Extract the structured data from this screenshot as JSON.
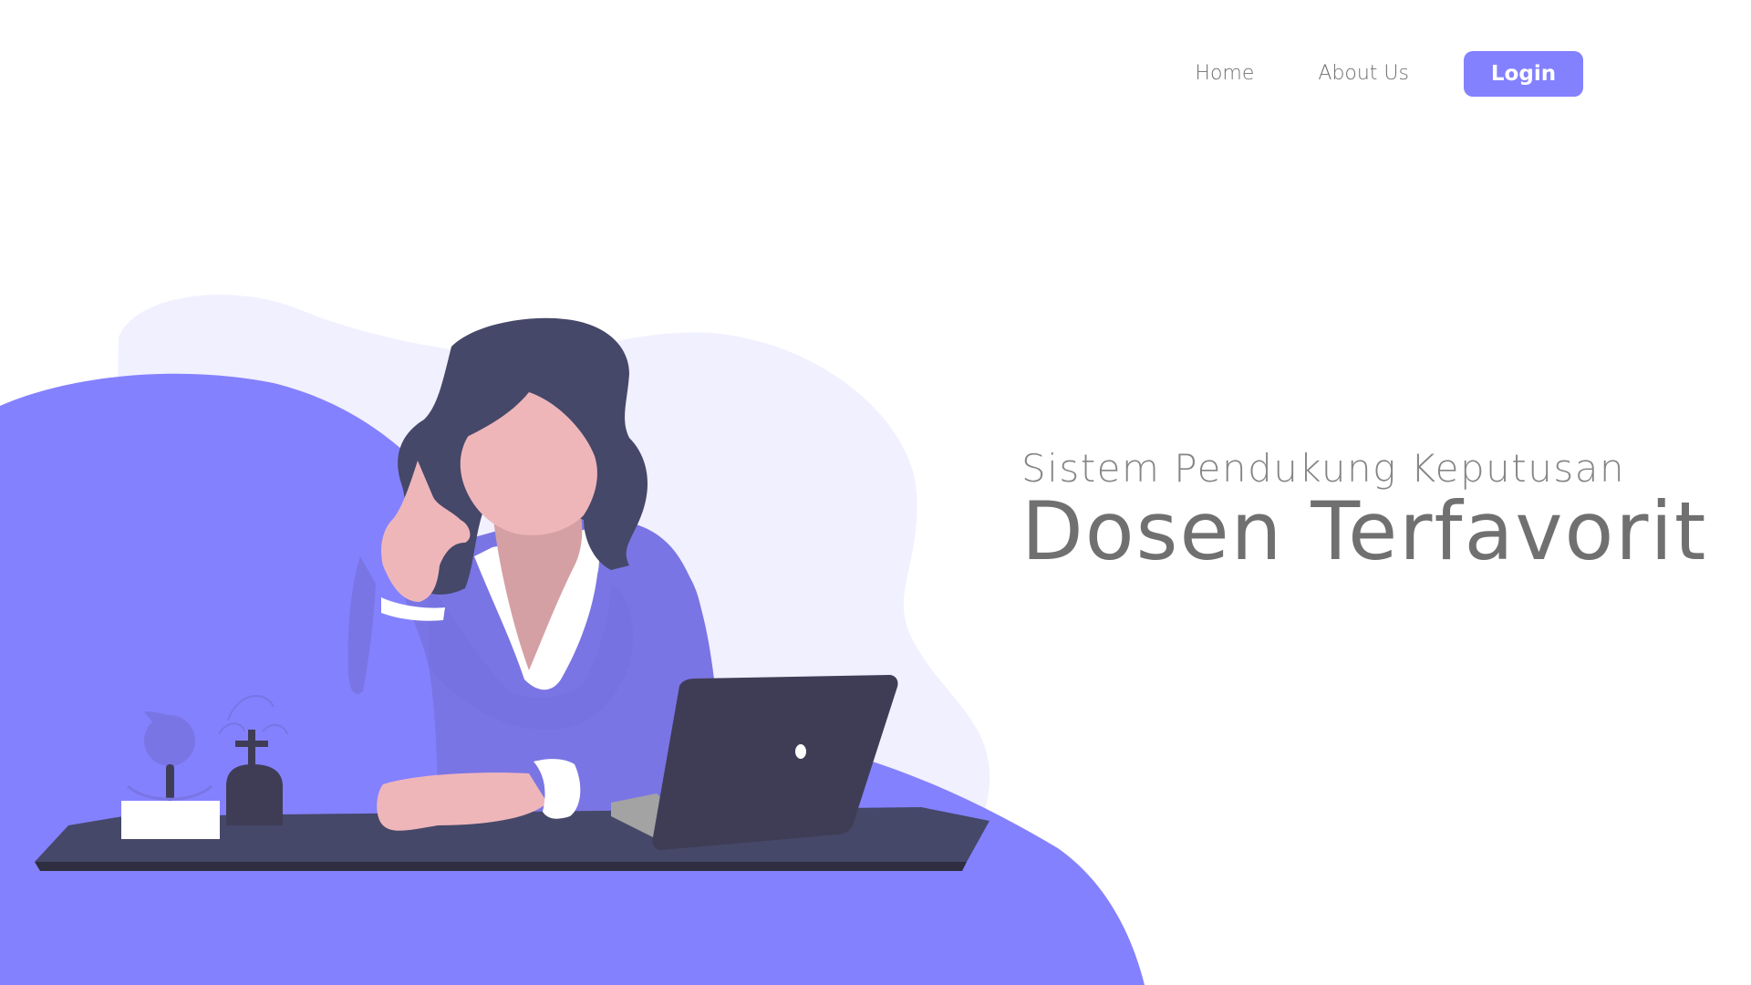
{
  "nav": {
    "home_label": "Home",
    "about_label": "About Us",
    "login_label": "Login"
  },
  "hero": {
    "subtitle": "Sistem Pendukung Keputusan",
    "title": "Dosen Terfavorit"
  },
  "colors": {
    "accent": "#8481ff",
    "light_blob": "#f1f0ff",
    "text": "#707070",
    "desk": "#454868",
    "laptop": "#3f3d56",
    "skin": "#efb6ba",
    "hair": "#454868"
  },
  "illustration": {
    "icon_name": "woman-at-laptop-illustration"
  }
}
